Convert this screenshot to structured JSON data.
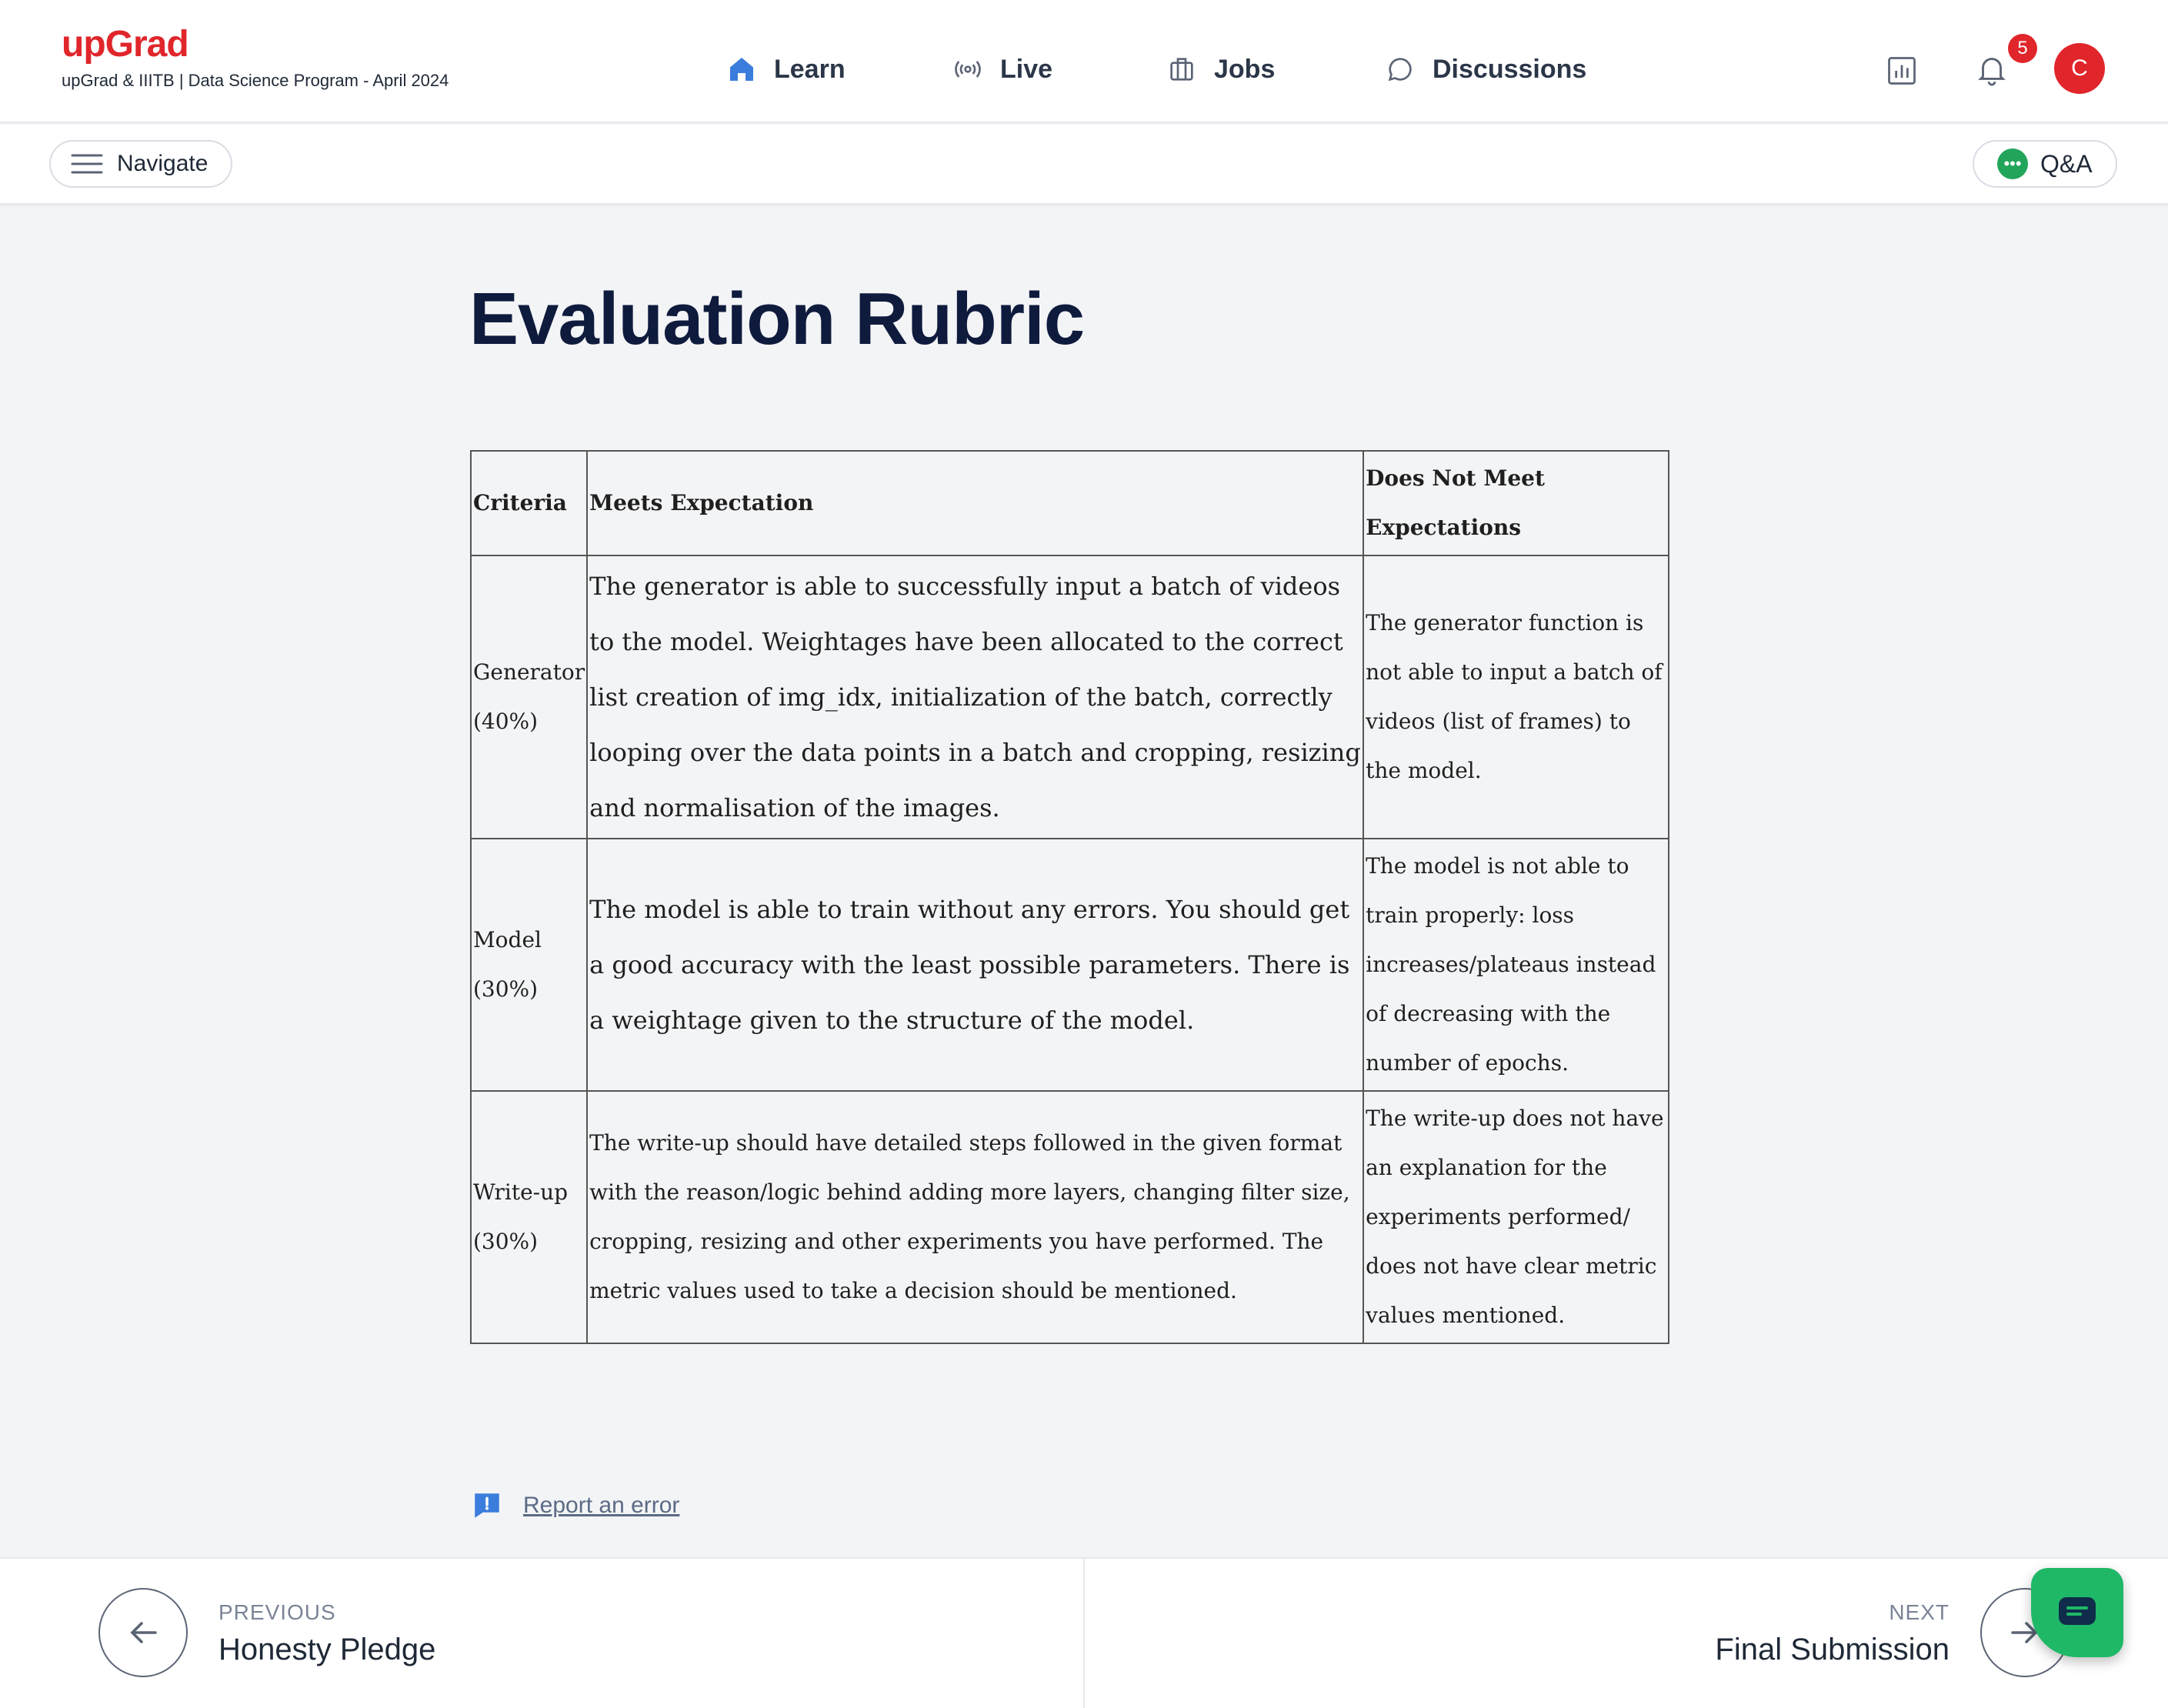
{
  "header": {
    "logo": "upGrad",
    "program": "upGrad & IIITB | Data Science Program - April 2024",
    "nav": [
      {
        "label": "Learn",
        "icon": "home-icon",
        "active": true
      },
      {
        "label": "Live",
        "icon": "broadcast-icon"
      },
      {
        "label": "Jobs",
        "icon": "briefcase-icon"
      },
      {
        "label": "Discussions",
        "icon": "chat-bubble-icon"
      }
    ],
    "notification_count": "5",
    "avatar_initial": "C"
  },
  "subbar": {
    "navigate_label": "Navigate",
    "qa_label": "Q&A"
  },
  "main": {
    "title": "Evaluation Rubric",
    "table": {
      "headers": [
        "Criteria",
        "Meets Expectation",
        "Does Not Meet Expectations"
      ],
      "rows": [
        {
          "criteria": "Generator (40%)",
          "meets": "The generator is able to successfully input a batch of videos to the model. Weightages have been allocated to the correct list creation of img_idx, initialization of the batch, correctly looping over the data points in a batch and cropping, resizing and normalisation of the images.",
          "not_meets": "The generator function is not able to input a batch of videos (list of frames) to the model."
        },
        {
          "criteria": "Model (30%)",
          "meets": "The model is able to train without any errors. You should get a good accuracy with the least possible parameters. There is a weightage given to the structure of the model.",
          "not_meets": "The model is not able to train properly: loss increases/plateaus instead of decreasing with the number of epochs."
        },
        {
          "criteria": "Write-up (30%)",
          "meets": "The write-up should have detailed steps followed in the given format with the reason/logic behind adding more layers, changing filter size, cropping, resizing and other experiments you have performed. The metric values used to take a decision should be mentioned.",
          "not_meets": "The write-up does not have an explanation for the experiments performed/ does not have clear metric values mentioned."
        }
      ]
    },
    "report_label": "Report an error"
  },
  "footer": {
    "previous_caption": "PREVIOUS",
    "previous_title": "Honesty Pledge",
    "next_caption": "NEXT",
    "next_title": "Final Submission"
  },
  "colors": {
    "brand": "#e0262b",
    "accent_blue": "#3b7ddd",
    "qa_green": "#22a55b",
    "chat_green": "#1fb867"
  }
}
